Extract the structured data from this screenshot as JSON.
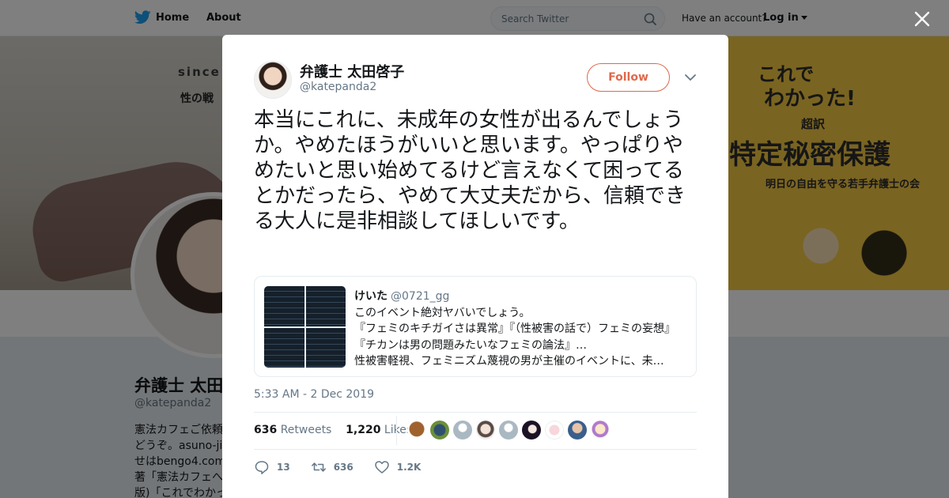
{
  "nav": {
    "home_label": "Home",
    "about_label": "About",
    "search_placeholder": "Search Twitter",
    "have_account": "Have an account?",
    "login_label": "Log in"
  },
  "background_profile": {
    "banner_since": "since",
    "banner_subtitle": "性の戦",
    "book_title_1": "これで",
    "book_title_2": "わかった!",
    "book_badge": "超訳",
    "book_main": "特定秘密保護",
    "book_author": "明日の自由を守る若手弁護士の会",
    "name": "弁護士 太田",
    "handle": "@katepanda2",
    "bio_lines": [
      "憲法カフェご依頼",
      "どうぞ。asuno-jiy",
      "せはbengo4.com/",
      "著「憲法カフェへ",
      "版)「これでわかっ"
    ]
  },
  "tweet": {
    "author_name": "弁護士 太田啓子",
    "author_handle": "@katepanda2",
    "follow_label": "Follow",
    "text": "本当にこれに、未成年の女性が出るんでしょうか。やめたほうがいいと思います。やっぱりやめたいと思い始めてるけど言えなくて困ってるとかだったら、やめて大丈夫だから、信頼できる大人に是非相談してほしいです。",
    "quoted": {
      "name": "けいた",
      "handle": "@0721_gg",
      "line1": "このイベント絶対ヤバいでしょう。",
      "line2": "『フェミのキチガイさは異常』『（性被害の話で）フェミの妄想』",
      "line3": "『チカンは男の問題みたいなフェミの論法』…",
      "line4": "性被害軽視、フェミニズム蔑視の男が主催のイベントに、未…"
    },
    "timestamp": "5:33 AM - 2 Dec 2019",
    "retweets_count": "636",
    "retweets_label": "Retweets",
    "likes_count": "1,220",
    "likes_label": "Likes",
    "reply_count": "13",
    "retweet_action_count": "636",
    "like_action_count": "1.2K"
  },
  "colors": {
    "accent": "#e0684b",
    "twitter_blue": "#1da1f2",
    "muted": "#657786"
  }
}
